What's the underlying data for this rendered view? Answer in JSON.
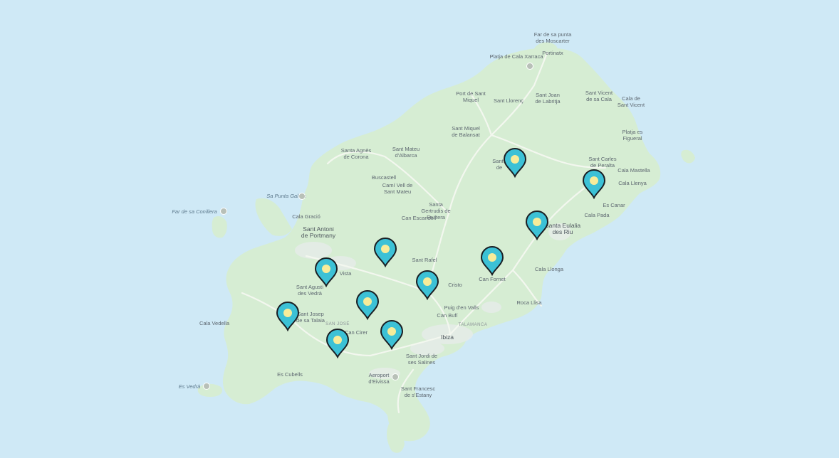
{
  "colors": {
    "water": "#cfe9f6",
    "land": "#d6edd3",
    "road": "#f3f7ef",
    "urban": "#e7ecea",
    "marker_fill": "#3cc1d6",
    "marker_stroke": "#1a1f24",
    "marker_dot": "#f7ec9a"
  },
  "place_labels": [
    {
      "id": "far-punta-moscarter-1",
      "text": "Far de sa punta"
    },
    {
      "id": "far-punta-moscarter-2",
      "text": "des Moscarter"
    },
    {
      "id": "portinatx",
      "text": "Portinatx"
    },
    {
      "id": "platja-cala-xarraca",
      "text": "Platja de Cala Xarraca"
    },
    {
      "id": "port-sant-miquel-1",
      "text": "Port de Sant"
    },
    {
      "id": "port-sant-miquel-2",
      "text": "Miquel"
    },
    {
      "id": "sant-llorenc",
      "text": "Sant Llorenç"
    },
    {
      "id": "sant-joan-1",
      "text": "Sant Joan"
    },
    {
      "id": "sant-joan-2",
      "text": "de Labritja"
    },
    {
      "id": "sant-vicent-1",
      "text": "Sant Vicent"
    },
    {
      "id": "sant-vicent-2",
      "text": "de sa Cala"
    },
    {
      "id": "cala-sant-vicent-1",
      "text": "Cala de"
    },
    {
      "id": "cala-sant-vicent-2",
      "text": "Sant Vicent"
    },
    {
      "id": "sant-miquel-balansat-1",
      "text": "Sant Miquel"
    },
    {
      "id": "sant-miquel-balansat-2",
      "text": "de Balansat"
    },
    {
      "id": "platja-figueral-1",
      "text": "Platja es"
    },
    {
      "id": "platja-figueral-2",
      "text": "Figueral"
    },
    {
      "id": "santa-agnes-1",
      "text": "Santa Agnès"
    },
    {
      "id": "santa-agnes-2",
      "text": "de Corona"
    },
    {
      "id": "sant-mateu-1",
      "text": "Sant Mateu"
    },
    {
      "id": "sant-mateu-2",
      "text": "d'Albarca"
    },
    {
      "id": "santa-gertrudis-partial-1",
      "text": "Sant"
    },
    {
      "id": "santa-gertrudis-partial-2",
      "text": "de"
    },
    {
      "id": "sant-carles-1",
      "text": "Sant Carles"
    },
    {
      "id": "sant-carles-2",
      "text": "de Peralta"
    },
    {
      "id": "cala-mastella",
      "text": "Cala Mastella"
    },
    {
      "id": "buscastell",
      "text": "Buscastell"
    },
    {
      "id": "cami-vell-1",
      "text": "Camí Vell de"
    },
    {
      "id": "cami-vell-2",
      "text": "Sant Mateu"
    },
    {
      "id": "cala-llenya",
      "text": "Cala Llenya"
    },
    {
      "id": "es-canar",
      "text": "Es Canar"
    },
    {
      "id": "santa-gertrudis-1",
      "text": "Santa"
    },
    {
      "id": "santa-gertrudis-2",
      "text": "Gertrudis de"
    },
    {
      "id": "santa-gertrudis-3",
      "text": "Fruitera"
    },
    {
      "id": "can-escandell",
      "text": "Can Escandell"
    },
    {
      "id": "cala-pada",
      "text": "Cala Pada"
    },
    {
      "id": "santa-eulalia-1",
      "text": "Santa Eulalia"
    },
    {
      "id": "santa-eulalia-2",
      "text": "des Riu"
    },
    {
      "id": "cala-gracio",
      "text": "Cala Gració"
    },
    {
      "id": "sant-antoni-1",
      "text": "Sant Antoni"
    },
    {
      "id": "sant-antoni-2",
      "text": "de Portmany"
    },
    {
      "id": "sant-rafel",
      "text": "Sant Rafel"
    },
    {
      "id": "cala-llonga",
      "text": "Cala Llonga"
    },
    {
      "id": "can-fornet",
      "text": "Can Fornet"
    },
    {
      "id": "bona-vista-partial",
      "text": "Vista"
    },
    {
      "id": "sant-agusti-1",
      "text": "Sant Agustí"
    },
    {
      "id": "sant-agusti-2",
      "text": "des Vedrà"
    },
    {
      "id": "jesus-partial",
      "text": "Cristo"
    },
    {
      "id": "roca-llisa",
      "text": "Roca Llisa"
    },
    {
      "id": "puig-den-valls",
      "text": "Puig d'en Valls"
    },
    {
      "id": "can-bufi",
      "text": "Can Bufí"
    },
    {
      "id": "sant-josep-1",
      "text": "Sant Josep"
    },
    {
      "id": "sant-josep-2",
      "text": "de sa Talaia"
    },
    {
      "id": "cala-vedella",
      "text": "Cala Vedella"
    },
    {
      "id": "can-cirer",
      "text": "Can Cirer"
    },
    {
      "id": "ibiza",
      "text": "Ibiza"
    },
    {
      "id": "sant-jordi-1",
      "text": "Sant Jordi de"
    },
    {
      "id": "sant-jordi-2",
      "text": "ses Salines"
    },
    {
      "id": "es-cubells",
      "text": "Es Cubells"
    },
    {
      "id": "aeroport-1",
      "text": "Aeroport"
    },
    {
      "id": "aeroport-2",
      "text": "d'Eivissa"
    },
    {
      "id": "sant-francesc-1",
      "text": "Sant Francesc"
    },
    {
      "id": "sant-francesc-2",
      "text": "de s'Estany"
    }
  ],
  "district_labels": [
    {
      "id": "san-jose",
      "text": "SAN JOSÉ"
    },
    {
      "id": "talamanca",
      "text": "TALAMANCA"
    }
  ],
  "sea_labels": [
    {
      "id": "sa-punta-galera",
      "text": "Sa Punta Galera"
    },
    {
      "id": "far-sa-conillera",
      "text": "Far de sa Conillera"
    },
    {
      "id": "es-vedra",
      "text": "Es Vedrà"
    }
  ],
  "markers": [
    {
      "id": "marker-1"
    },
    {
      "id": "marker-2"
    },
    {
      "id": "marker-3"
    },
    {
      "id": "marker-4"
    },
    {
      "id": "marker-5"
    },
    {
      "id": "marker-6"
    },
    {
      "id": "marker-7"
    },
    {
      "id": "marker-8"
    },
    {
      "id": "marker-9"
    },
    {
      "id": "marker-10"
    },
    {
      "id": "marker-11"
    }
  ]
}
